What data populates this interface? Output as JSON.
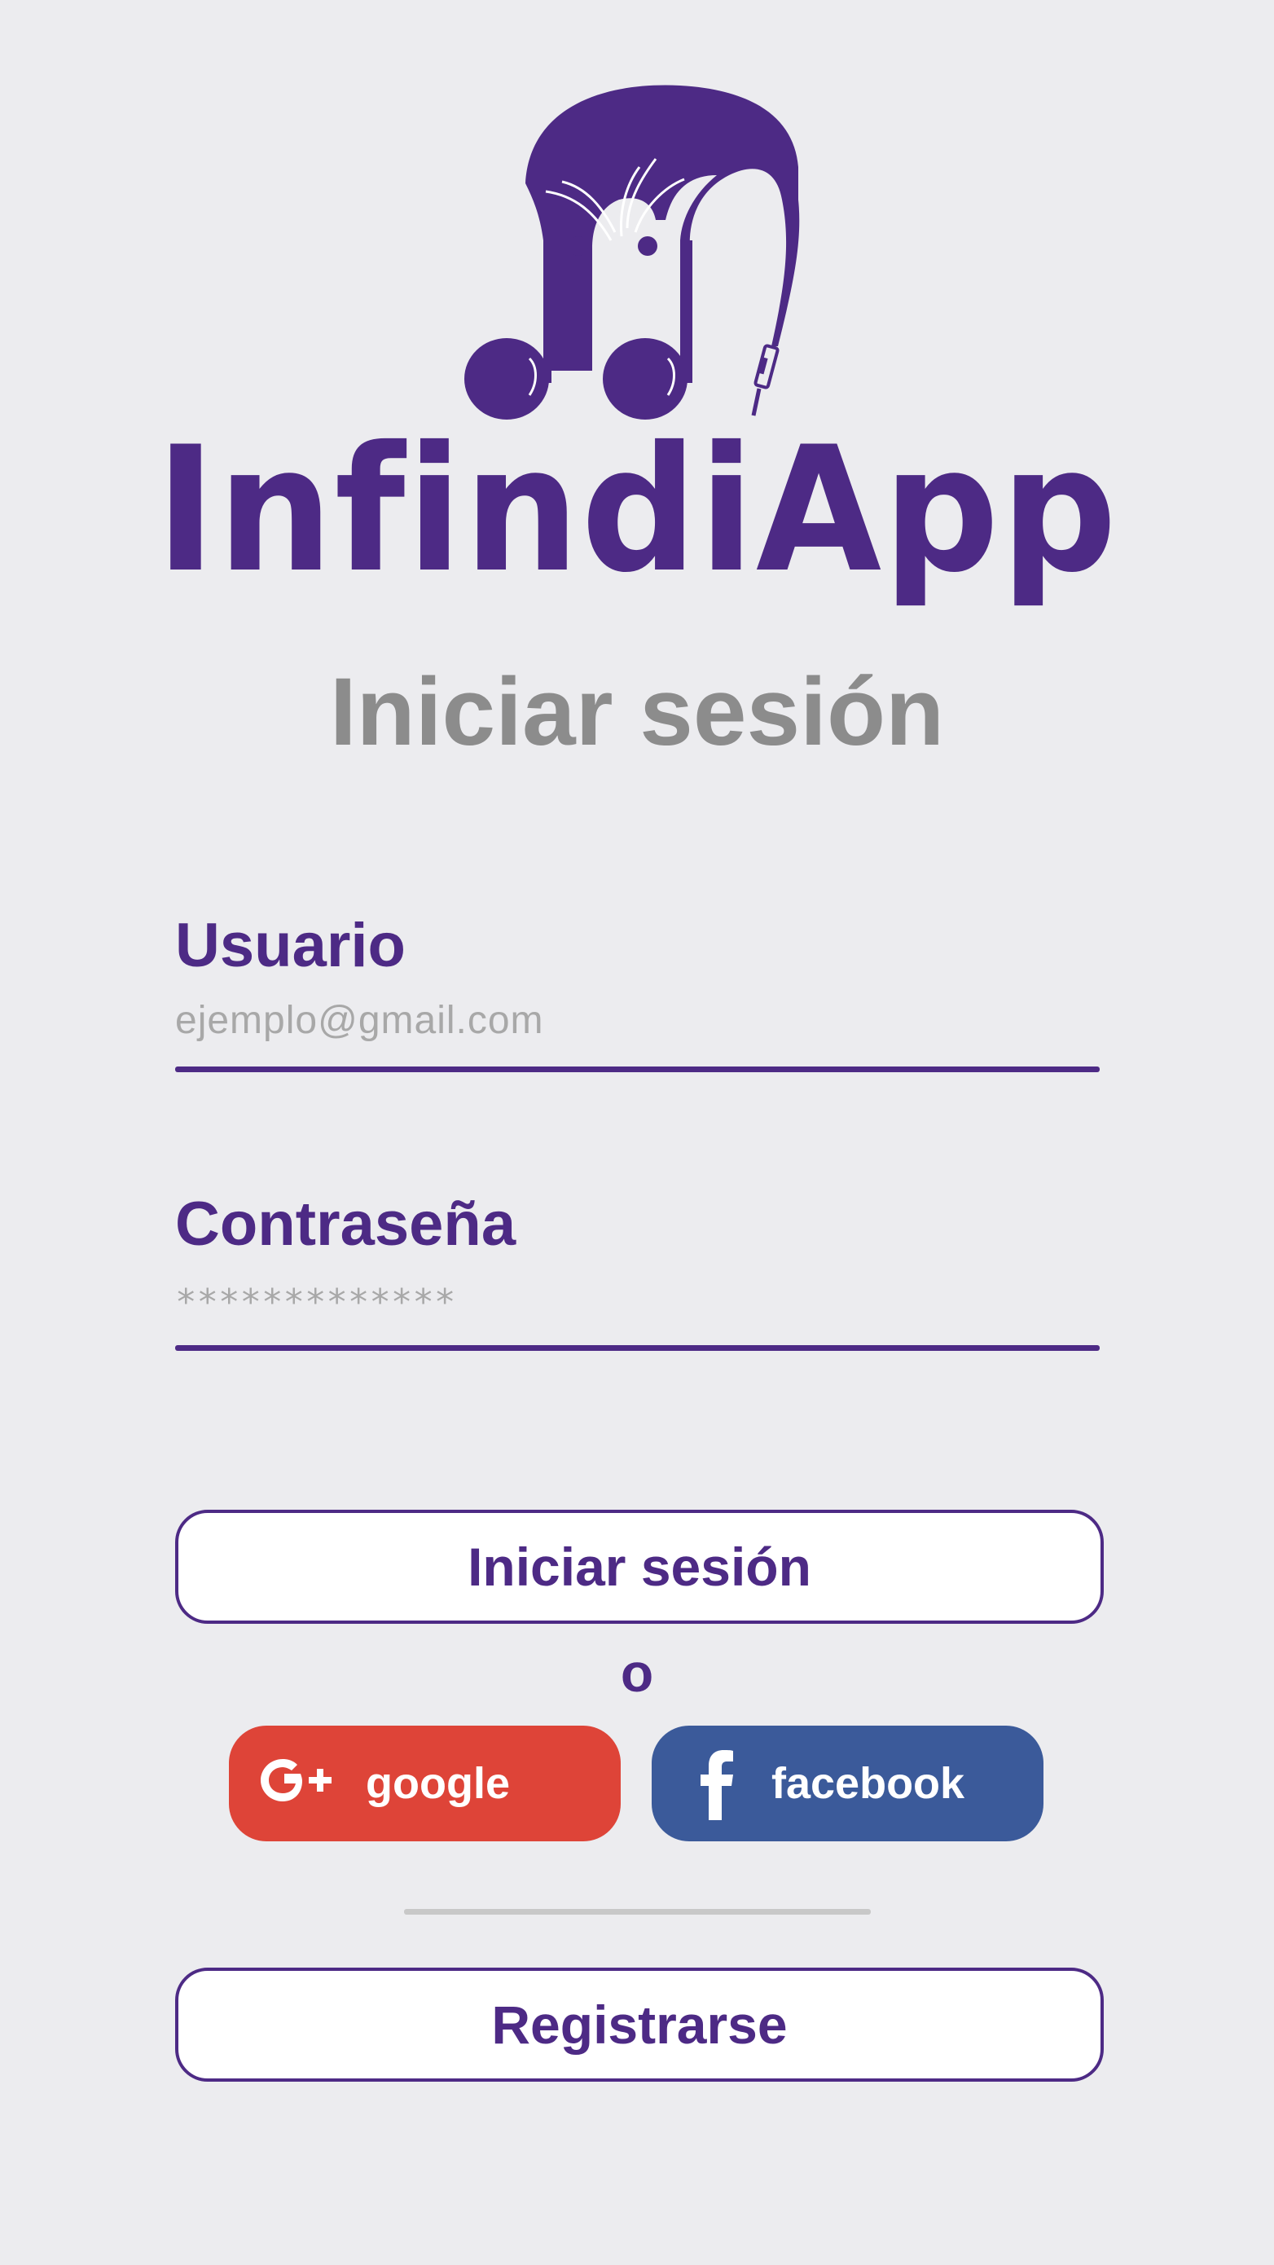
{
  "app": {
    "name": "InfindiApp",
    "screen_title": "Iniciar sesión",
    "brand_color": "#4d2a85"
  },
  "form": {
    "username": {
      "label": "Usuario",
      "placeholder": "ejemplo@gmail.com"
    },
    "password": {
      "label": "Contraseña",
      "masked_value": "*************"
    }
  },
  "actions": {
    "login_label": "Iniciar sesión",
    "or_label": "o",
    "google_label": "google",
    "google_color": "#de4438",
    "facebook_label": "facebook",
    "facebook_color": "#3b5a9a",
    "register_label": "Registrarse"
  },
  "icons": {
    "logo": "music-notes-headphones-logo-icon",
    "google": "google-plus-icon",
    "facebook": "facebook-icon"
  }
}
